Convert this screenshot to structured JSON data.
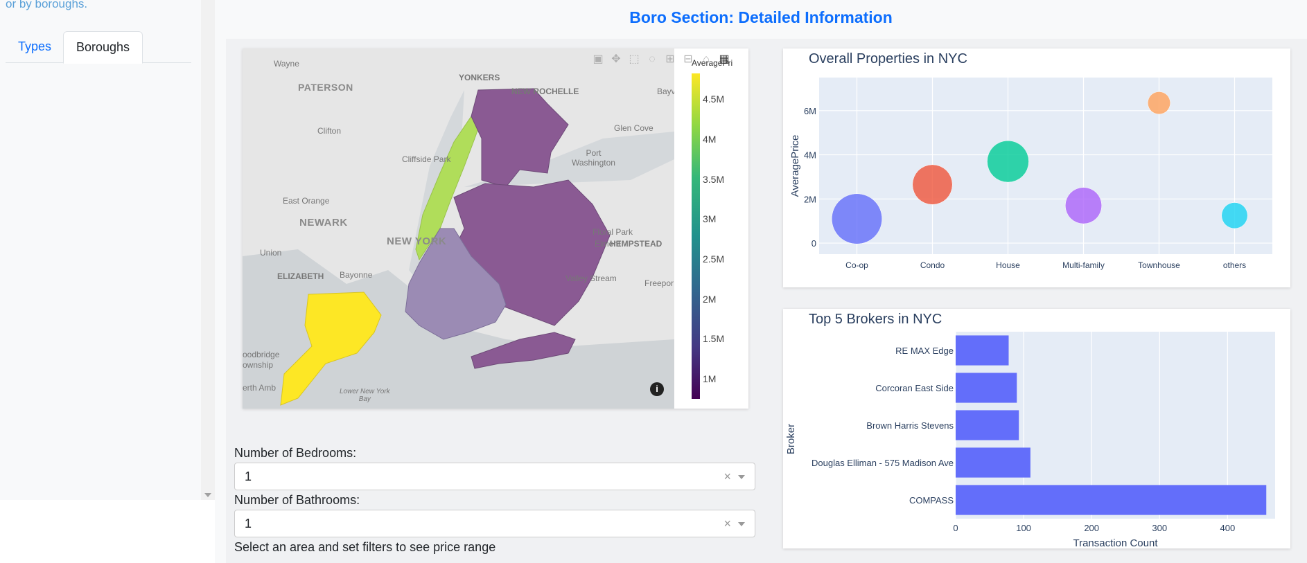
{
  "sidebar": {
    "intro_fragment": "or by boroughs.",
    "tabs": [
      {
        "label": "Types",
        "active": false
      },
      {
        "label": "Boroughs",
        "active": true
      }
    ]
  },
  "page_title": "Boro Section: Detailed Information",
  "map": {
    "colorbar_title": "AveragePri",
    "colorbar_ticks": [
      "4.5M",
      "4M",
      "3.5M",
      "3M",
      "2.5M",
      "2M",
      "1.5M",
      "1M"
    ],
    "colorscale": "viridis",
    "labels": {
      "wayne": "Wayne",
      "yonkers": "YONKERS",
      "paterson": "PATERSON",
      "new_rochelle": "NEW ROCHELLE",
      "bayv": "Bayv",
      "clifton": "Clifton",
      "glen_cove": "Glen Cove",
      "port_washington": "Port\nWashington",
      "cliffside_park": "Cliffside Park",
      "east_orange": "East Orange",
      "newark": "NEWARK",
      "new_york": "NEW YORK",
      "floral_park": "Floral Park",
      "elmont": "Elmont",
      "hempstead": "HEMPSTEAD",
      "union": "Union",
      "elizabeth": "ELIZABETH",
      "bayonne": "Bayonne",
      "valley_stream": "Valley Stream",
      "freepor": "Freepor",
      "woodbridge": "oodbridge",
      "township": "ownship",
      "perth_amboy": "erth Amb",
      "lower_ny_bay": "Lower New York\nBay"
    },
    "info_icon": "i",
    "toolbar_icons": [
      "camera-icon",
      "pan-icon",
      "box-select-icon",
      "lasso-icon",
      "zoom-in-icon",
      "zoom-out-icon",
      "reset-icon",
      "plotly-logo-icon"
    ]
  },
  "filters": {
    "bedrooms": {
      "label": "Number of Bedrooms:",
      "value": "1",
      "clear": "×"
    },
    "bathrooms": {
      "label": "Number of Bathrooms:",
      "value": "1",
      "clear": "×"
    },
    "helper": "Select an area and set filters to see price range"
  },
  "chart_data": [
    {
      "type": "scatter",
      "title": "Overall Properties in NYC",
      "xlabel": "",
      "ylabel": "AveragePrice",
      "categories": [
        "Co-op",
        "Condo",
        "House",
        "Multi-family",
        "Townhouse",
        "others"
      ],
      "values": [
        1100000,
        2650000,
        3700000,
        1700000,
        6350000,
        1250000
      ],
      "bubble_sizes": [
        58,
        46,
        48,
        42,
        26,
        30
      ],
      "colors": [
        "#636efa",
        "#ef553b",
        "#00cc96",
        "#ab63fa",
        "#ffa15a",
        "#19d3f3"
      ],
      "yticks": [
        "0",
        "2M",
        "4M",
        "6M"
      ],
      "ylim": [
        -500000,
        7500000
      ],
      "grid": true
    },
    {
      "type": "bar",
      "orientation": "horizontal",
      "title": "Top 5 Brokers in NYC",
      "xlabel": "Transaction Count",
      "ylabel": "Broker",
      "categories": [
        "RE MAX Edge",
        "Corcoran East Side",
        "Brown Harris Stevens",
        "Douglas Elliman - 575 Madison Ave",
        "COMPASS"
      ],
      "values": [
        78,
        90,
        93,
        110,
        457
      ],
      "xticks": [
        "0",
        "100",
        "200",
        "300",
        "400"
      ],
      "xlim": [
        0,
        470
      ],
      "color": "#636efa",
      "grid": true
    }
  ]
}
